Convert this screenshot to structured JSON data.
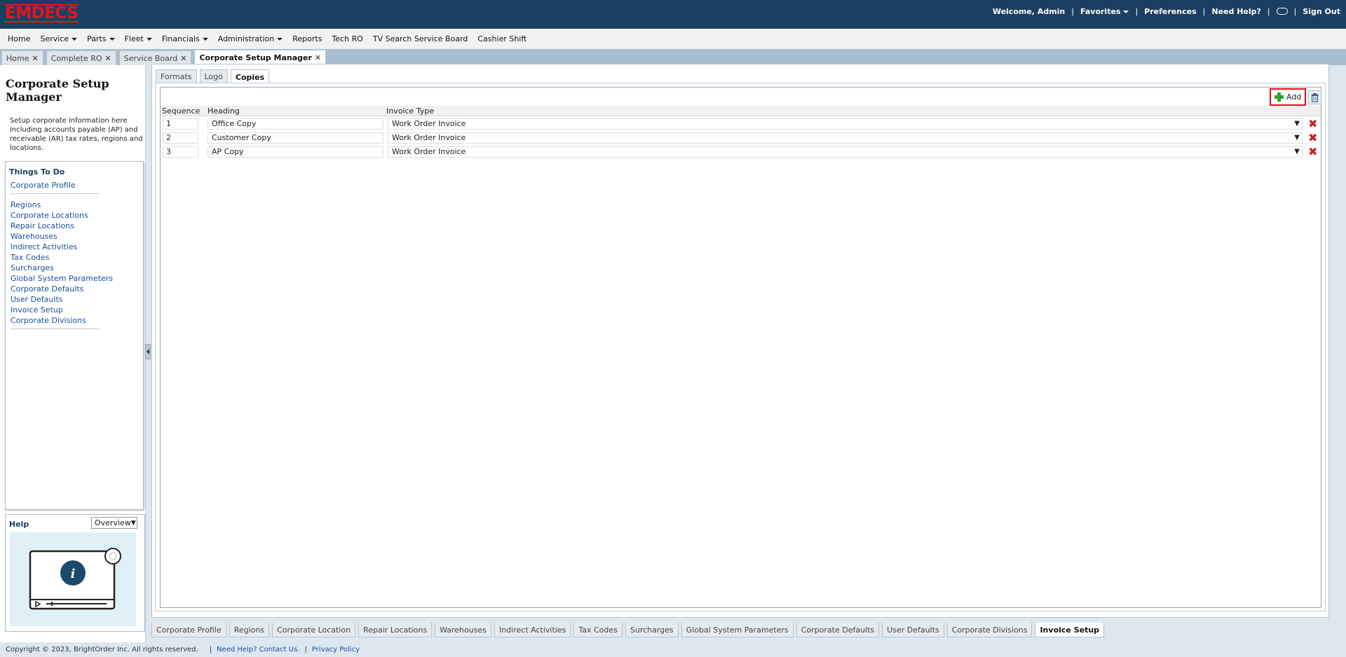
{
  "app": {
    "logo_text": "EMDECS",
    "brand_color": "#e8141a",
    "header_color": "#1c3f61"
  },
  "top_links": {
    "welcome": "Welcome, Admin",
    "favorites": "Favorites",
    "preferences": "Preferences",
    "need_help": "Need Help?",
    "sign_out": "Sign Out"
  },
  "menu": {
    "items": [
      {
        "label": "Home",
        "dropdown": false
      },
      {
        "label": "Service",
        "dropdown": true
      },
      {
        "label": "Parts",
        "dropdown": true
      },
      {
        "label": "Fleet",
        "dropdown": true
      },
      {
        "label": "Financials",
        "dropdown": true
      },
      {
        "label": "Administration",
        "dropdown": true
      },
      {
        "label": "Reports",
        "dropdown": false
      },
      {
        "label": "Tech RO",
        "dropdown": false
      },
      {
        "label": "TV Search Service Board",
        "dropdown": false
      },
      {
        "label": "Cashier Shift",
        "dropdown": false
      }
    ]
  },
  "page_tabs": [
    {
      "label": "Home",
      "active": false
    },
    {
      "label": "Complete RO",
      "active": false
    },
    {
      "label": "Service Board",
      "active": false
    },
    {
      "label": "Corporate Setup Manager",
      "active": true
    }
  ],
  "left_panel": {
    "title": "Corporate Setup Manager",
    "description": "Setup corporate information here including accounts payable (AP) and receivable (AR) tax rates, regions and locations.",
    "things_to_do": {
      "heading": "Things To Do",
      "first": "Corporate Profile",
      "items": [
        "Regions",
        "Corporate Locations",
        "Repair Locations",
        "Warehouses",
        "Indirect Activities",
        "Tax Codes",
        "Surcharges",
        "Global System Parameters",
        "Corporate Defaults",
        "User Defaults",
        "Invoice Setup",
        "Corporate Divisions"
      ]
    },
    "help": {
      "heading": "Help",
      "selected": "Overview"
    }
  },
  "sub_tabs": [
    {
      "label": "Formats",
      "active": false
    },
    {
      "label": "Logo",
      "active": false
    },
    {
      "label": "Copies",
      "active": true
    }
  ],
  "grid": {
    "add_label": "Add",
    "columns": {
      "sequence": "Sequence",
      "heading": "Heading",
      "invoice_type": "Invoice Type"
    },
    "rows": [
      {
        "sequence": "1",
        "heading": "Office Copy",
        "invoice_type": "Work Order Invoice"
      },
      {
        "sequence": "2",
        "heading": "Customer Copy",
        "invoice_type": "Work Order Invoice"
      },
      {
        "sequence": "3",
        "heading": "AP Copy",
        "invoice_type": "Work Order Invoice"
      }
    ]
  },
  "bottom_tabs": [
    {
      "label": "Corporate Profile",
      "active": false
    },
    {
      "label": "Regions",
      "active": false
    },
    {
      "label": "Corporate Location",
      "active": false
    },
    {
      "label": "Repair Locations",
      "active": false
    },
    {
      "label": "Warehouses",
      "active": false
    },
    {
      "label": "Indirect Activities",
      "active": false
    },
    {
      "label": "Tax Codes",
      "active": false
    },
    {
      "label": "Surcharges",
      "active": false
    },
    {
      "label": "Global System Parameters",
      "active": false
    },
    {
      "label": "Corporate Defaults",
      "active": false
    },
    {
      "label": "User Defaults",
      "active": false
    },
    {
      "label": "Corporate Divisions",
      "active": false
    },
    {
      "label": "Invoice Setup",
      "active": true
    }
  ],
  "footer": {
    "copyright": "Copyright © 2023, BrightOrder Inc. All rights reserved.",
    "contact": "Need Help? Contact Us.",
    "privacy": "Privacy Policy"
  }
}
